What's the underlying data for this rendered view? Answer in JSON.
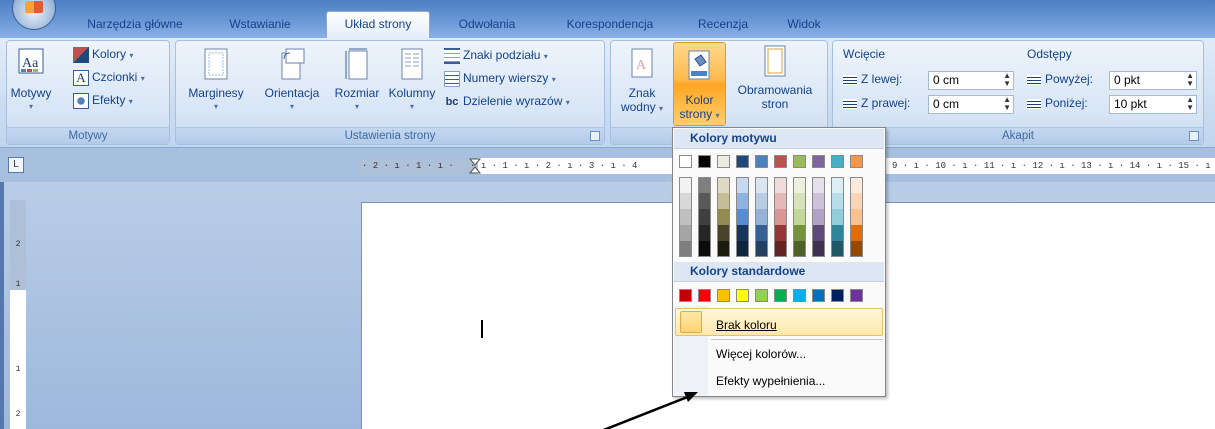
{
  "tabs": [
    {
      "label": "Narzędzia główne",
      "x": 0
    },
    {
      "label": "Wstawianie"
    },
    {
      "label": "Układ strony",
      "active": true
    },
    {
      "label": "Odwołania"
    },
    {
      "label": "Korespondencja"
    },
    {
      "label": "Recenzja"
    },
    {
      "label": "Widok"
    }
  ],
  "ribbon": {
    "motywy": {
      "motywy_label": "Motywy",
      "kolory": "Kolory",
      "czcionki": "Czcionki",
      "efekty": "Efekty",
      "group": "Motywy"
    },
    "ustawienia": {
      "marginesy": "Marginesy",
      "orientacja": "Orientacja",
      "rozmiar": "Rozmiar",
      "kolumny": "Kolumny",
      "znaki_podzialu": "Znaki podziału",
      "numery_wierszy": "Numery wierszy",
      "dzielenie": "Dzielenie wyrazów",
      "group": "Ustawienia strony"
    },
    "tlo": {
      "znak_1": "Znak",
      "znak_2": "wodny",
      "kolor_1": "Kolor",
      "kolor_2": "strony",
      "obram_1": "Obramowania",
      "obram_2": "stron"
    },
    "akapit": {
      "wciecie": "Wcięcie",
      "z_lewej": "Z lewej:",
      "z_lewej_val": "0 cm",
      "z_prawej": "Z prawej:",
      "z_prawej_val": "0 cm",
      "odstepy": "Odstępy",
      "powyzej": "Powyżej:",
      "powyzej_val": "0 pkt",
      "ponizej": "Poniżej:",
      "ponizej_val": "10 pkt",
      "group": "Akapit"
    }
  },
  "ruler": {
    "text": "· 2 · ı · 1 · ı ·   · ı · 1 · ı · 2 · ı · 3 · ı · 4",
    "text_right": "9 · ı · 10 · ı · 11 · ı · 12 · ı · 13 · ı · 14 · ı · 15 · ı ·",
    "tab_glyph": "L"
  },
  "dropdown": {
    "theme_header": "Kolory motywu",
    "standard_header": "Kolory standardowe",
    "no_color": "Brak koloru",
    "more_colors": "Więcej kolorów...",
    "fill_effects": "Efekty wypełnienia...",
    "theme_top": [
      "#ffffff",
      "#000000",
      "#eeece1",
      "#1f497d",
      "#4f81bd",
      "#c0504d",
      "#9bbb59",
      "#8064a2",
      "#4bacc6",
      "#f79646"
    ],
    "theme_shades": [
      [
        "#f2f2f2",
        "#d8d8d8",
        "#bfbfbf",
        "#a5a5a5",
        "#7f7f7f"
      ],
      [
        "#7f7f7f",
        "#595959",
        "#3f3f3f",
        "#262626",
        "#0c0c0c"
      ],
      [
        "#ddd9c3",
        "#c4bd97",
        "#938953",
        "#494429",
        "#1d1b10"
      ],
      [
        "#c6d9f0",
        "#8db3e2",
        "#548dd4",
        "#17365d",
        "#0f243e"
      ],
      [
        "#dbe5f1",
        "#b8cce4",
        "#95b3d7",
        "#366092",
        "#244061"
      ],
      [
        "#f2dcdb",
        "#e5b9b7",
        "#d99694",
        "#953734",
        "#632423"
      ],
      [
        "#ebf1dd",
        "#d7e3bc",
        "#c3d69b",
        "#76923c",
        "#4f6128"
      ],
      [
        "#e5e0ec",
        "#ccc1d9",
        "#b2a2c7",
        "#5f497a",
        "#3f3151"
      ],
      [
        "#dbeef3",
        "#b7dde8",
        "#92cddc",
        "#31859b",
        "#205867"
      ],
      [
        "#fdeada",
        "#fbd5b5",
        "#fac08f",
        "#e36c09",
        "#974806"
      ]
    ],
    "standard": [
      "#c00000",
      "#ff0000",
      "#ffc000",
      "#ffff00",
      "#92d050",
      "#00b050",
      "#00b0f0",
      "#0070c0",
      "#002060",
      "#7030a0"
    ]
  }
}
